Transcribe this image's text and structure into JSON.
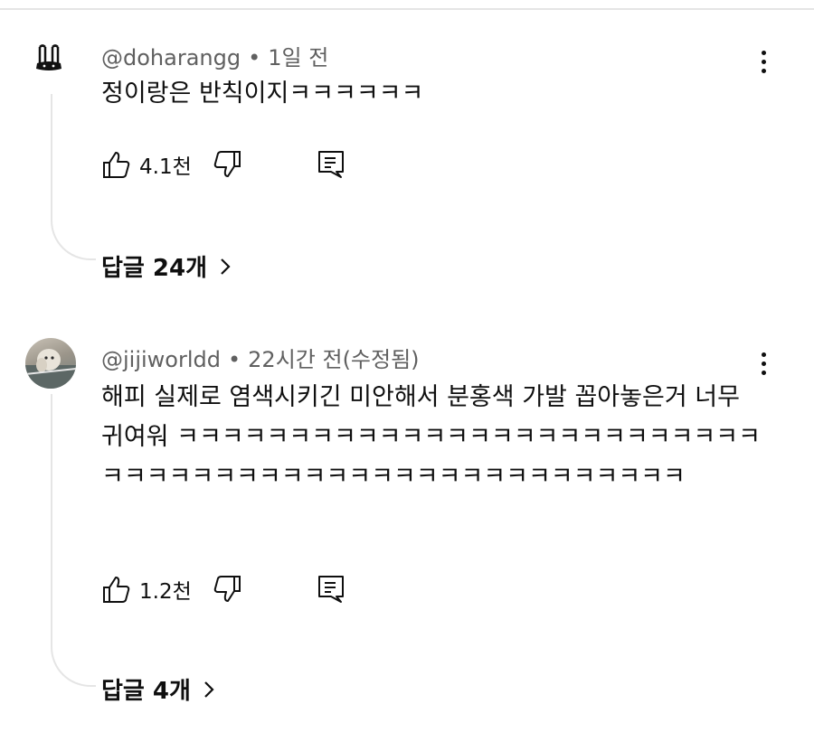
{
  "comments": [
    {
      "author": "@doharangg",
      "time": "1일 전",
      "text": "정이랑은 반칙이지ㅋㅋㅋㅋㅋㅋ",
      "likes": "4.1천",
      "replies": "답글 24개",
      "avatar_icon": "bunny-logo-icon"
    },
    {
      "author": "@jijiworldd",
      "time": "22시간 전(수정됨)",
      "text": "해피 실제로 염색시키긴 미안해서 분홍색 가발 꼽아놓은거 너무 귀여워 ㅋㅋㅋㅋㅋㅋㅋㅋㅋㅋㅋㅋㅋㅋㅋㅋㅋㅋㅋㅋㅋㅋㅋㅋㅋㅋㅋㅋㅋㅋㅋㅋㅋㅋㅋㅋㅋㅋㅋㅋㅋㅋㅋㅋㅋㅋㅋㅋㅋㅋㅋㅋ",
      "likes": "1.2천",
      "replies": "답글 4개",
      "avatar_icon": "dog-photo-avatar"
    }
  ],
  "icons": {
    "like": "thumb-up-icon",
    "dislike": "thumb-down-icon",
    "reply": "reply-comment-icon",
    "more": "more-vertical-icon",
    "chevron": "chevron-right-icon"
  },
  "colors": {
    "text": "#0f0f0f",
    "meta": "#606060",
    "divider": "#e5e5e5"
  }
}
